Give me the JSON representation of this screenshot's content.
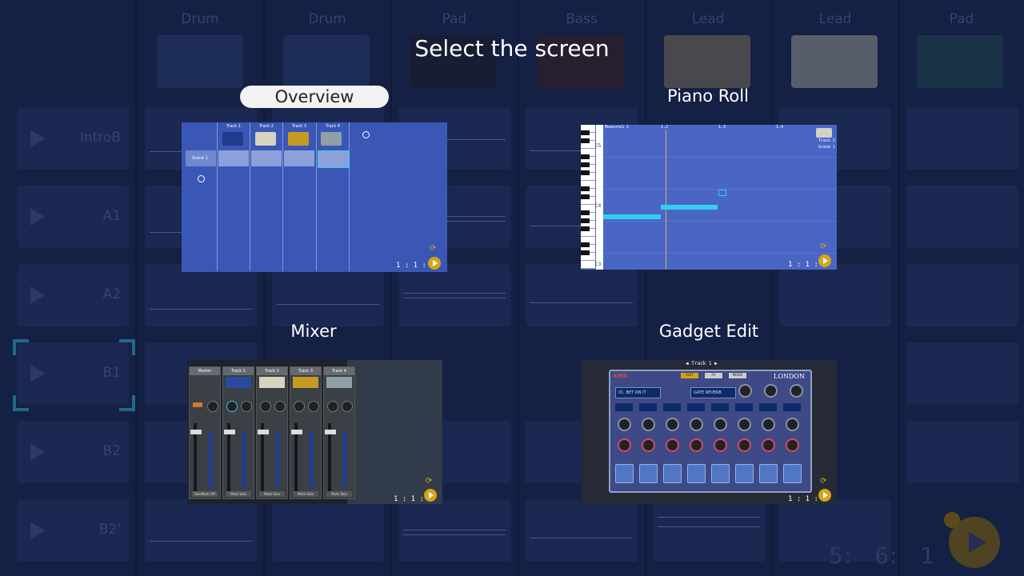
{
  "tracks": [
    {
      "label": "Drum",
      "color": "#2a3c6e"
    },
    {
      "label": "Drum",
      "color": "#2a3c6e"
    },
    {
      "label": "Pad",
      "color": "#1a1a1a"
    },
    {
      "label": "Bass",
      "color": "#3a2014"
    },
    {
      "label": "Lead",
      "color": "#8a7a56"
    },
    {
      "label": "Lead",
      "color": "#a8a89a"
    },
    {
      "label": "Pad",
      "color": "#1f4a4c"
    }
  ],
  "scenes": [
    "IntroB",
    "A1",
    "A2",
    "B1",
    "B2",
    "B2'"
  ],
  "selected_scene": "B1",
  "counter": {
    "measure": "5:",
    "beat": "6:",
    "tick": "1"
  },
  "dialog": {
    "title": "Select the screen",
    "options": {
      "overview": {
        "label": "Overview",
        "selected": true,
        "position": "1 : 1 : 4",
        "tracks": [
          "Track 1",
          "Track 2",
          "Track 3",
          "Track 4"
        ],
        "scene": "Scene 1"
      },
      "piano_roll": {
        "label": "Piano Roll",
        "position": "1 : 1 : 2",
        "measure": "Measure1 1",
        "ticks": [
          "1.2",
          "1.3",
          "1.4"
        ],
        "keys": [
          "C5",
          "C4",
          "C3"
        ],
        "track": "Track 2",
        "scene": "Scene 1"
      },
      "mixer": {
        "label": "Mixer",
        "position": "1 : 1 : 1",
        "strips": [
          "Master",
          "Track 1",
          "Track 2",
          "Track 3",
          "Track 4"
        ],
        "solo_label": "Solo",
        "mute_label": "Mute",
        "master_footer": "SoloMute Off"
      },
      "gadget_edit": {
        "label": "Gadget Edit",
        "position": "1 : 1 : 4",
        "track": "Track 1",
        "brand": "KORG",
        "gadget_name": "LONDON",
        "drumkit": "01. BET ON IT",
        "effect": "GATE REVERB",
        "modes": [
          "EDIT",
          "FX",
          "MIXER"
        ]
      }
    }
  },
  "colors": {
    "background": "#152045",
    "accent": "#d6a516",
    "highlight": "#2fd0ee",
    "overview_bg": "#3b57b5",
    "piano_bg": "#4a66c4"
  }
}
